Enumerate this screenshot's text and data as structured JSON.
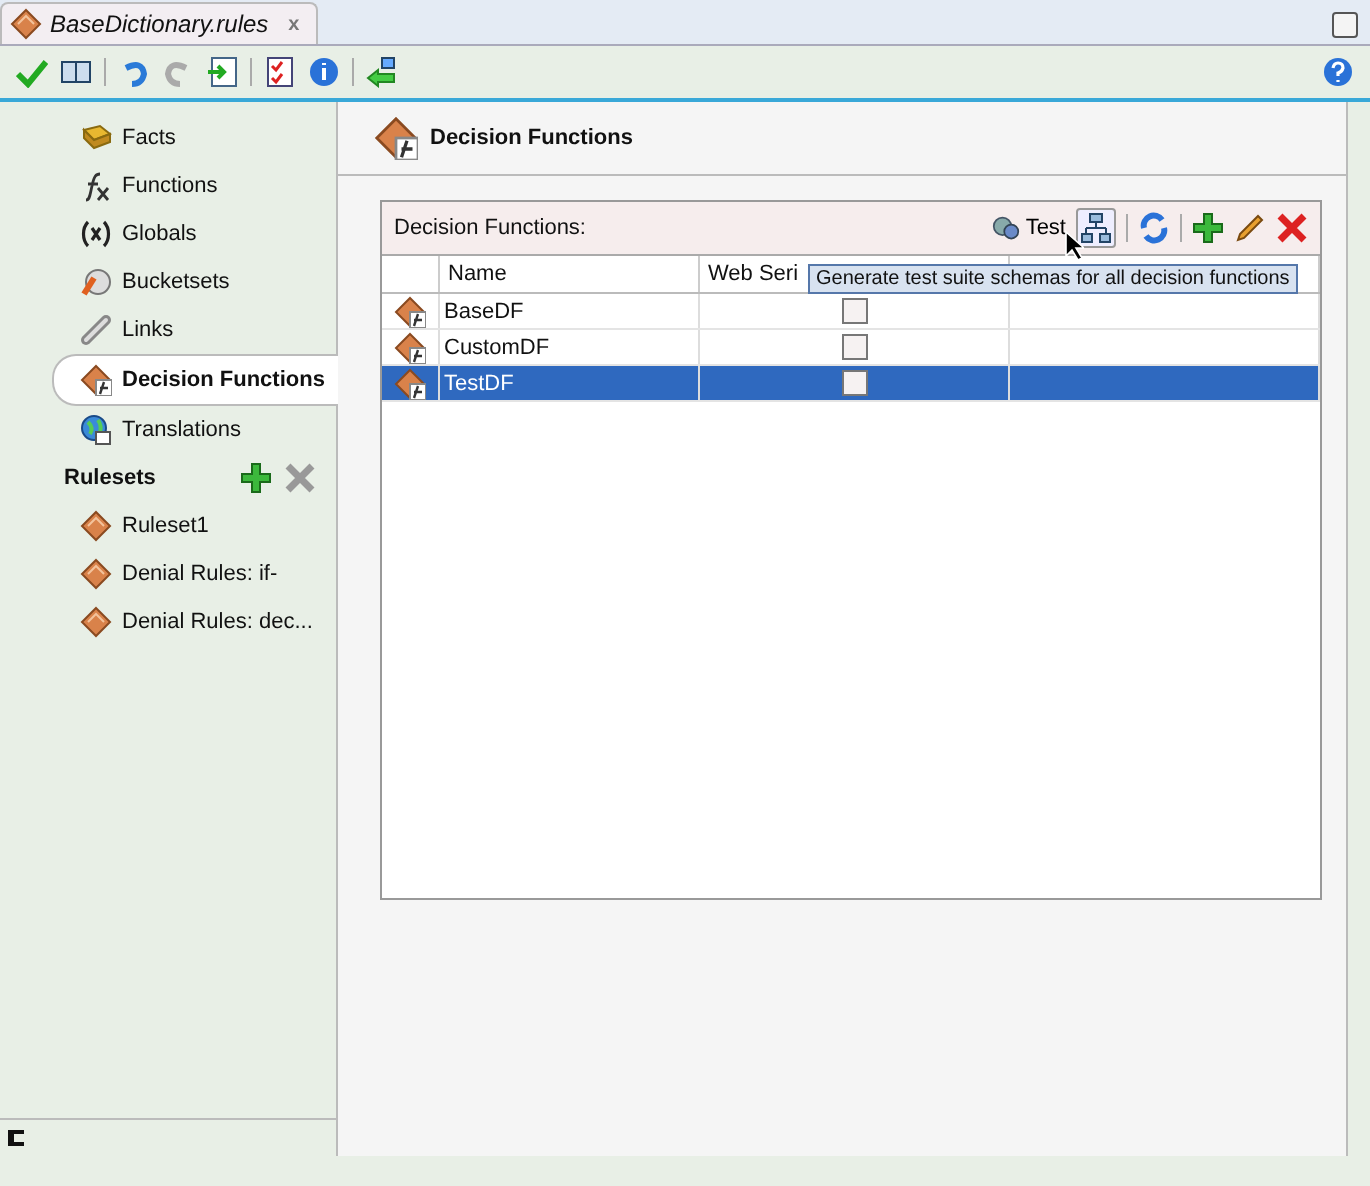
{
  "tab": {
    "title": "BaseDictionary.rules",
    "close": "x"
  },
  "sidebar": {
    "items": [
      {
        "label": "Facts",
        "selected": false
      },
      {
        "label": "Functions",
        "selected": false
      },
      {
        "label": "Globals",
        "selected": false
      },
      {
        "label": "Bucketsets",
        "selected": false
      },
      {
        "label": "Links",
        "selected": false
      },
      {
        "label": "Decision Functions",
        "selected": true
      },
      {
        "label": "Translations",
        "selected": false
      }
    ],
    "rulesets_title": "Rulesets",
    "rulesets": [
      {
        "label": "Ruleset1"
      },
      {
        "label": "Denial Rules: if-"
      },
      {
        "label": "Denial Rules: dec..."
      }
    ]
  },
  "panel": {
    "title": "Decision Functions",
    "table_title": "Decision Functions:",
    "test_label": "Test",
    "columns": [
      "Name",
      "Web Seri",
      ""
    ],
    "rows": [
      {
        "name": "BaseDF",
        "web_service": false,
        "selected": false
      },
      {
        "name": "CustomDF",
        "web_service": false,
        "selected": false
      },
      {
        "name": "TestDF",
        "web_service": false,
        "selected": true
      }
    ],
    "tooltip": "Generate test suite schemas for all decision functions"
  }
}
